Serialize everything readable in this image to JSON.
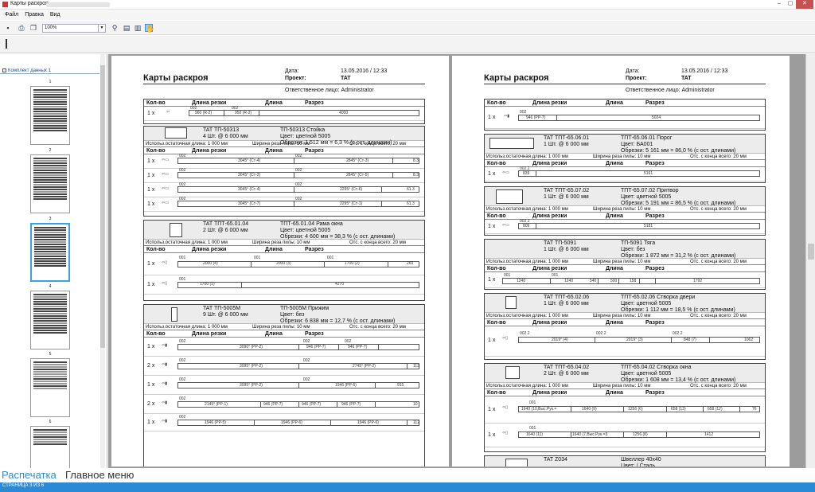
{
  "window": {
    "title": "Карты раскроя",
    "minimize": "–",
    "maximize": "▢",
    "close": "✕"
  },
  "menu": [
    "Файл",
    "Правка",
    "Вид"
  ],
  "toolbar": {
    "zoom": "100%"
  },
  "icons": {
    "save": "save-icon",
    "print": "print-icon",
    "copy": "copy-icon",
    "zoom": "magnifier-icon",
    "page": "page-icon",
    "pages": "pages-icon",
    "hand": "hand-icon"
  },
  "sidebar": {
    "header": "Комплект данных 1",
    "thumbnails": [
      "1",
      "2",
      "3",
      "4",
      "5",
      "6"
    ]
  },
  "page1": {
    "title": "Карты раскроя",
    "date_label": "Дата:",
    "date": "13.05.2016 / 12:33",
    "project_label": "Проект:",
    "project": "TAT",
    "responsible": "Ответственное лицо:  Administrator",
    "cols": {
      "qty": "Кол-во",
      "cut": "Длина резки",
      "len": "Длина",
      "cut2": "Разрез"
    },
    "blocks": [
      {
        "code": "TAT ТП-50313",
        "count": "4 Шт. @ 6 000 мм",
        "name": "ТП-50313 Стойка",
        "color": "Цвет: цветной 5005",
        "waste": "Обрезки: 1 512 мм = 6,3 % (с ост. длинами)",
        "rows": [
          {
            "qty": "1 x",
            "labels": [
              "002",
              "3045° (Ст-4)",
              "002",
              "2845° (Ст-3)",
              "8.3"
            ]
          },
          {
            "qty": "1 x",
            "labels": [
              "002",
              "3045° (Ст-2)",
              "002",
              "2845° (Ст-5)",
              "8.3"
            ]
          },
          {
            "qty": "1 x",
            "labels": [
              "002",
              "3045° (Ст-4)",
              "002",
              "2295° (Ст-6)",
              "61.3"
            ]
          },
          {
            "qty": "1 x",
            "labels": [
              "002",
              "3045° (Ст-7)",
              "002",
              "2295° (Ст-1)",
              "61.3"
            ]
          }
        ]
      },
      {
        "code": "TAT ТПТ-65.01.04",
        "count": "2 Шт. @ 6 000 мм",
        "name": "ТПТ-65.01.04 Рама окна",
        "color": "Цвет: цветной 5005",
        "waste": "Обрезки: 4 600 мм = 38,3 % (с ост. длинами)",
        "rows": [
          {
            "qty": "1 x",
            "labels": [
              "001",
              "2000 (4)",
              "001",
              "2000 (3)",
              "001",
              "1700 (2)",
              "260"
            ]
          },
          {
            "qty": "1 x",
            "labels": [
              "001",
              "1700 (1)",
              "4270"
            ]
          }
        ]
      },
      {
        "code": "TAT ТП-5005М",
        "count": "9 Шт. @ 6 000 мм",
        "name": "ТП-5005М Прижим",
        "color": "Цвет: без",
        "waste": "Обрезки: 6 838 мм = 12,7 % (с ост. длинами)",
        "rows": [
          {
            "qty": "1 x",
            "labels": [
              "002",
              "3090° (РР-2)",
              "002",
              "946 (РР-7)",
              "002",
              "946 (РР-7)"
            ]
          },
          {
            "qty": "2 x",
            "labels": [
              "002",
              "3095° (РР-2)",
              "002",
              "2745° (РР-2)",
              "113"
            ]
          },
          {
            "qty": "1 x",
            "labels": [
              "002",
              "3095° (РР-2)",
              "002",
              "1946 (РР-5)",
              "915"
            ]
          },
          {
            "qty": "2 x",
            "labels": [
              "002",
              "2145° (РР-1)",
              "946 (РР-7)",
              "946 (РР-7)",
              "946 (РР-7)",
              "10"
            ]
          },
          {
            "qty": "1 x",
            "labels": [
              "002",
              "1946 (РР-5)",
              "1946 (РР-6)",
              "1946 (РР-6)",
              "112"
            ]
          }
        ]
      }
    ],
    "first_row": {
      "qty": "1 x",
      "labels": [
        "002",
        "960 (R-2)",
        "002",
        "950 (R-2)",
        "4000"
      ]
    }
  },
  "page2": {
    "title": "Карты раскроя",
    "date_label": "Дата:",
    "date": "13.05.2016 / 12:33",
    "project_label": "Проект:",
    "project": "TAT",
    "responsible": "Ответственное лицо:  Administrator",
    "first_row": {
      "qty": "1 x",
      "labels": [
        "002",
        "946 (РР-7)",
        "5024"
      ]
    },
    "blocks": [
      {
        "code": "TAT ТПТ-65.06.01",
        "count": "1 Шт. @ 6 000 мм",
        "name": "ТПТ-65.06.01 Порог",
        "color": "Цвет: БА001",
        "waste": "Обрезки: 5 161 мм = 86,0 % (с ост. длинами)",
        "rows": [
          {
            "qty": "1 x",
            "labels": [
              "002.2",
              "839",
              "5161"
            ]
          }
        ]
      },
      {
        "code": "TAT ТПТ-65.07.02",
        "count": "1 Шт. @ 6 000 мм",
        "name": "ТПТ-65.07.02 Притвор",
        "color": "Цвет: цветной 5005",
        "waste": "Обрезки: 5 191 мм = 86,5 % (с ост. длинами)",
        "rows": [
          {
            "qty": "1 x",
            "labels": [
              "002.2",
              "809",
              "5181"
            ]
          }
        ]
      },
      {
        "code": "TAT ТП-5091",
        "count": "1 Шт. @ 6 000 мм",
        "name": "ТП-5091 Тяга",
        "color": "Цвет: без",
        "waste": "Обрезки: 1 872 мм = 31,2 % (с ост. длинами)",
        "rows": [
          {
            "qty": "1 x",
            "labels": [
              "001",
              "1240",
              "001",
              "1240",
              "540",
              "500",
              "158",
              "1792"
            ]
          }
        ]
      },
      {
        "code": "TAT ТПТ-65.02.06",
        "count": "1 Шт. @ 6 000 мм",
        "name": "ТПТ-65.02.06 Створка двери",
        "color": "Цвет: цветной 5005",
        "waste": "Обрезки: 1 112 мм = 18,5 % (с ост. длинами)",
        "rows": [
          {
            "qty": "1 x",
            "labels": [
              "002.2",
              "2019° (4)",
              "002.2",
              "2019° (3)",
              "002.2",
              "848 (7)",
              "1062"
            ]
          }
        ]
      },
      {
        "code": "TAT ТПТ-65.04.02",
        "count": "2 Шт. @ 6 000 мм",
        "name": "ТПТ-65.04.02 Створка окна",
        "color": "Цвет: цветной 5005",
        "waste": "Обрезки: 1 608 мм = 13,4 % (с ост. длинами)",
        "rows": [
          {
            "qty": "1 x",
            "labels": [
              "001",
              "1640 (10,Выс.Рук.=",
              "1640 (9)",
              "1256 (6)",
              "658 (13)",
              "658 (12)",
              "76"
            ]
          },
          {
            "qty": "1 x",
            "labels": [
              "001",
              "1640 (11)",
              "1640 (7,Выс.Рук.=3",
              "1256 (8)",
              "1412"
            ]
          }
        ]
      },
      {
        "code": "TAT Z034",
        "count": "",
        "name": "Швеллер 40х40",
        "color": "Цвет: / Сталь",
        "waste": "",
        "rows": []
      }
    ]
  },
  "params": {
    "rest": "Использ.остаточная длина:  1 000 мм",
    "saw": "Ширина реза пилы:  10 мм",
    "end": "Отс. с конца всего:  20 мм"
  },
  "bottom_tabs": {
    "active": "Распечатка",
    "inactive": "Главное меню"
  },
  "status": "СТРАНИЦА 3 ИЗ 6"
}
